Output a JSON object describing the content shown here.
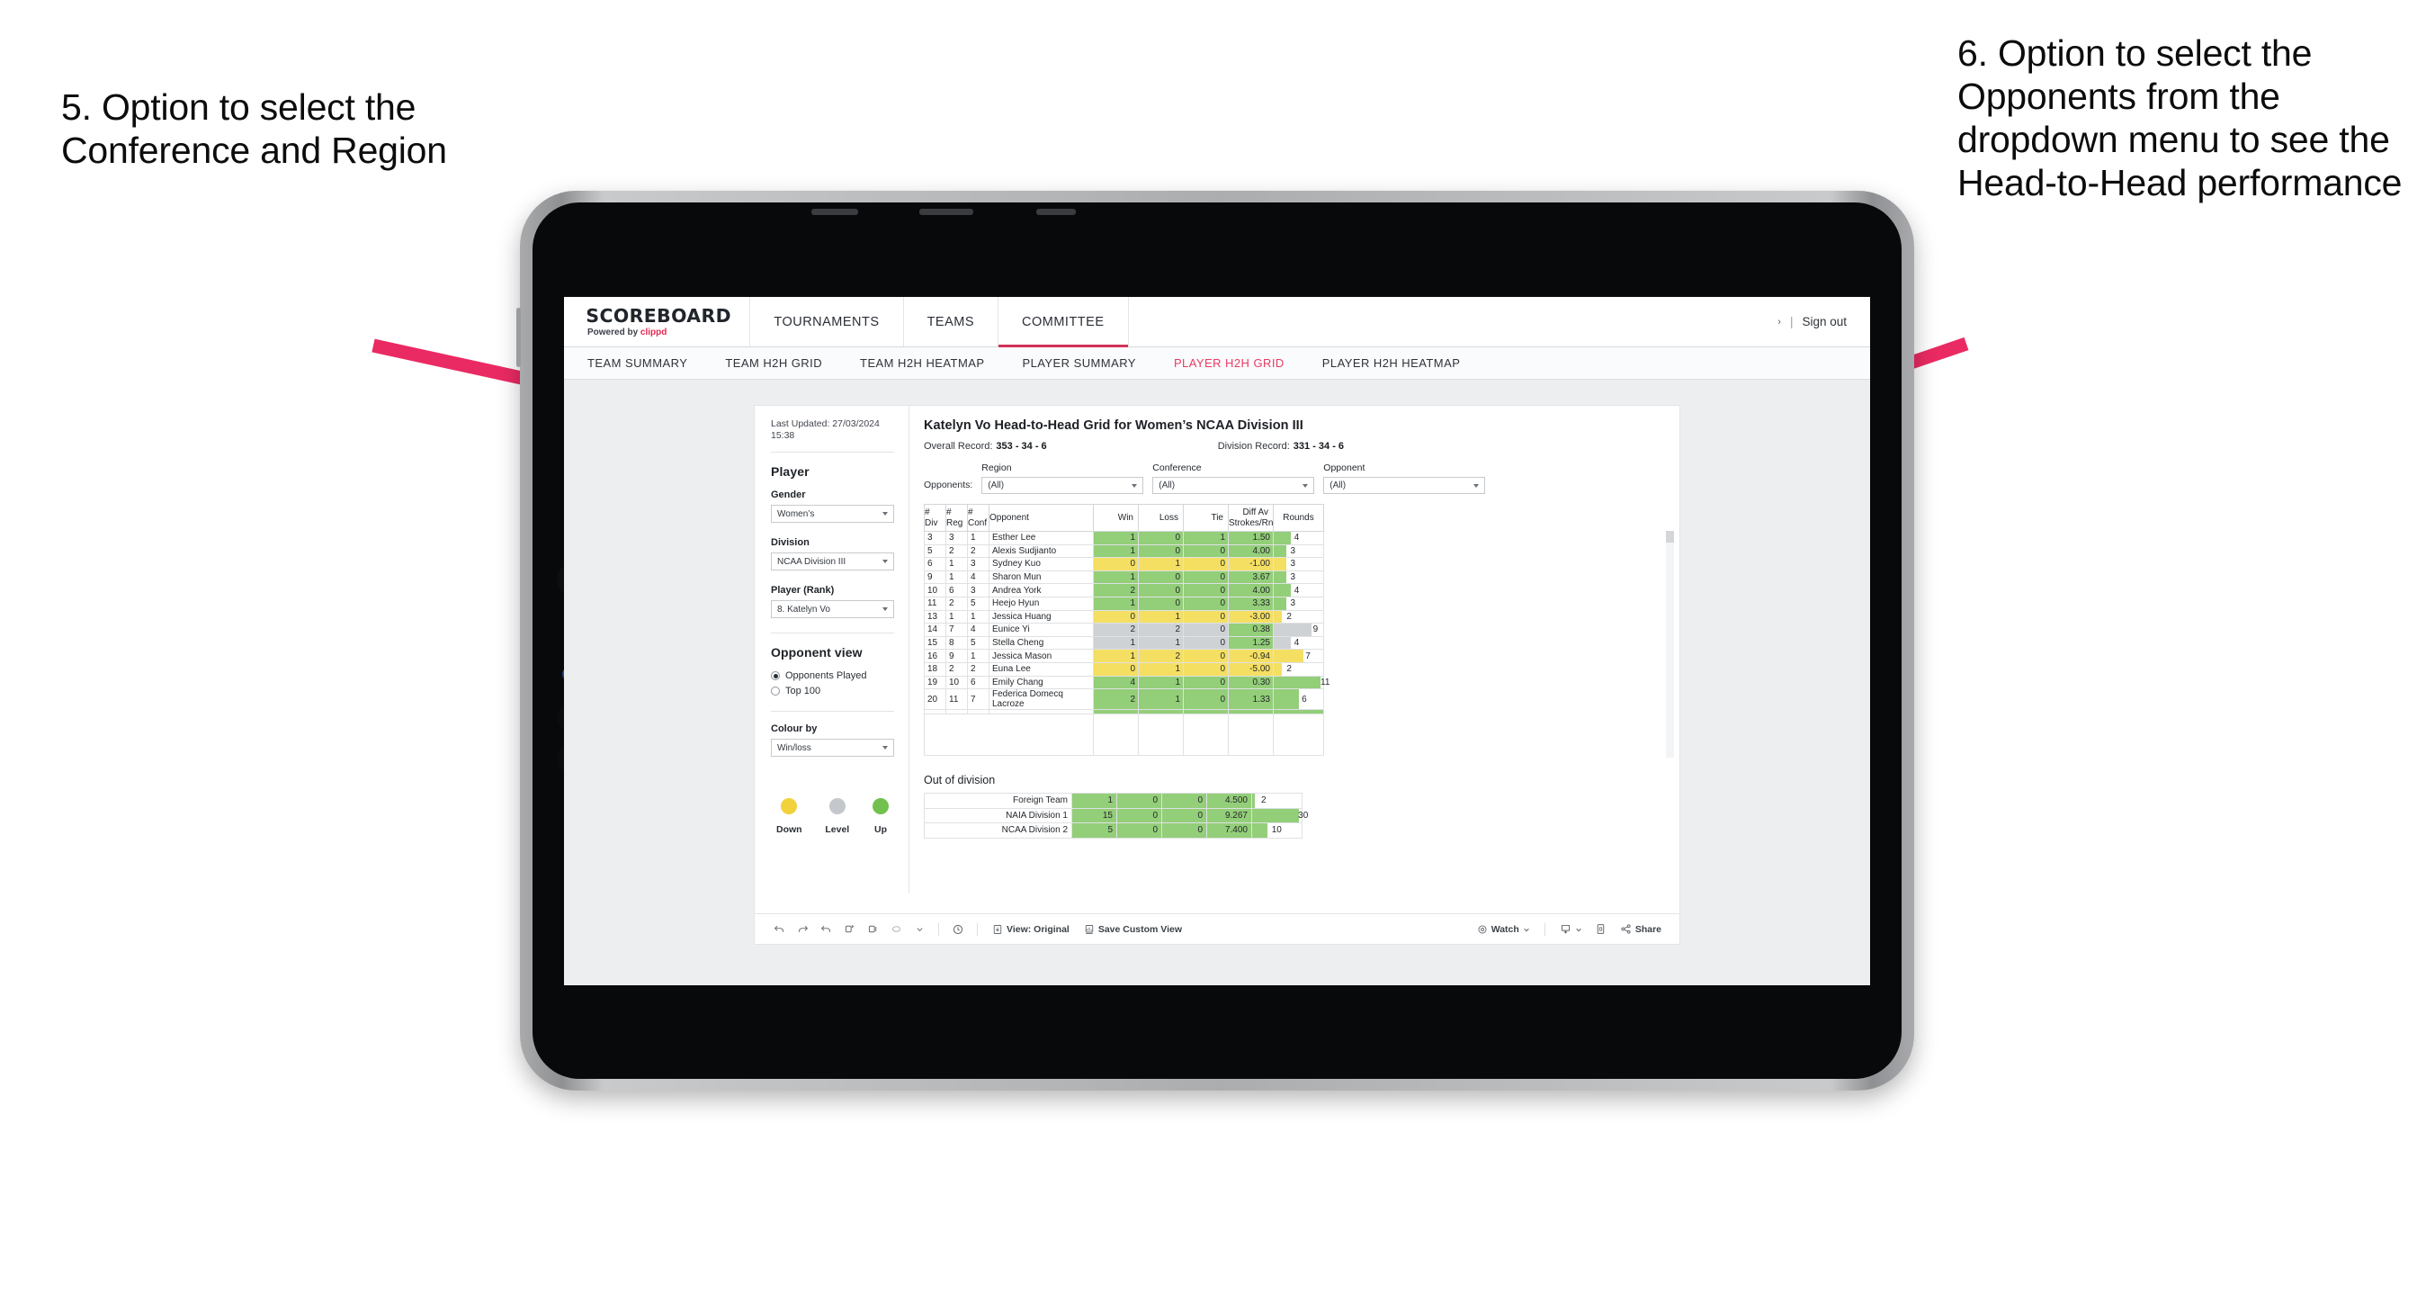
{
  "annotations": {
    "left": "5. Option to select the Conference and Region",
    "right": "6. Option to select the Opponents from the dropdown menu to see the Head-to-Head performance",
    "arrow_color": "#ea2a63"
  },
  "appbar": {
    "logo": "SCOREBOARD",
    "logo_sub_prefix": "Powered by ",
    "logo_sub_brand": "clippd",
    "nav": [
      {
        "label": "TOURNAMENTS",
        "active": false
      },
      {
        "label": "TEAMS",
        "active": false
      },
      {
        "label": "COMMITTEE",
        "active": true
      }
    ],
    "user_caret": "›",
    "separator": "|",
    "sign_out": "Sign out"
  },
  "subnav": [
    {
      "label": "TEAM SUMMARY",
      "active": false
    },
    {
      "label": "TEAM H2H GRID",
      "active": false
    },
    {
      "label": "TEAM H2H HEATMAP",
      "active": false
    },
    {
      "label": "PLAYER SUMMARY",
      "active": false
    },
    {
      "label": "PLAYER H2H GRID",
      "active": true
    },
    {
      "label": "PLAYER H2H HEATMAP",
      "active": false
    }
  ],
  "sidebar": {
    "last_updated": "Last Updated: 27/03/2024 15:38",
    "player_heading": "Player",
    "fields": [
      {
        "label": "Gender",
        "value": "Women’s"
      },
      {
        "label": "Division",
        "value": "NCAA Division III"
      },
      {
        "label": "Player (Rank)",
        "value": "8. Katelyn Vo"
      }
    ],
    "opponent_view_heading": "Opponent view",
    "opponent_view_options": [
      {
        "label": "Opponents Played",
        "selected": true
      },
      {
        "label": "Top 100",
        "selected": false
      }
    ],
    "colour_by_label": "Colour by",
    "colour_by_value": "Win/loss",
    "legend": [
      {
        "label": "Down",
        "color": "#f2d13b"
      },
      {
        "label": "Level",
        "color": "#c4c8cc"
      },
      {
        "label": "Up",
        "color": "#72c14e"
      }
    ]
  },
  "main": {
    "title": "Katelyn Vo Head-to-Head Grid for Women’s NCAA Division III",
    "overall_record_label": "Overall Record:",
    "overall_record_value": "353 - 34 - 6",
    "division_record_label": "Division Record:",
    "division_record_value": "331 - 34 - 6",
    "opponents_label": "Opponents:",
    "filters": [
      {
        "label": "Region",
        "value": "(All)"
      },
      {
        "label": "Conference",
        "value": "(All)"
      },
      {
        "label": "Opponent",
        "value": "(All)"
      }
    ],
    "out_of_division_heading": "Out of division"
  },
  "chart_data": {
    "type": "table",
    "title": "Katelyn Vo Head-to-Head Grid for Women’s NCAA Division III",
    "colors": {
      "up": "#93ce78",
      "down": "#f5df62",
      "level": "#cfd2d5"
    },
    "columns": [
      "# Div",
      "# Reg",
      "# Conf",
      "Opponent",
      "Win",
      "Loss",
      "Tie",
      "Diff Av Strokes/Rnd",
      "Rounds"
    ],
    "headers": [
      {
        "l1": "#",
        "l2": "Div"
      },
      {
        "l1": "#",
        "l2": "Reg"
      },
      {
        "l1": "#",
        "l2": "Conf"
      },
      {
        "l1": "Opponent",
        "l2": ""
      },
      {
        "l1": "Win",
        "l2": ""
      },
      {
        "l1": "Loss",
        "l2": ""
      },
      {
        "l1": "Tie",
        "l2": ""
      },
      {
        "l1": "Diff Av",
        "l2": "Strokes/Rnd"
      },
      {
        "l1": "Rounds",
        "l2": ""
      }
    ],
    "rounds_max": 11,
    "rows": [
      {
        "div": "3",
        "reg": "3",
        "conf": "1",
        "opponent": "Esther Lee",
        "win": "1",
        "loss": "0",
        "tie": "1",
        "diff": "1.50",
        "rounds": "4",
        "state": "up"
      },
      {
        "div": "5",
        "reg": "2",
        "conf": "2",
        "opponent": "Alexis Sudjianto",
        "win": "1",
        "loss": "0",
        "tie": "0",
        "diff": "4.00",
        "rounds": "3",
        "state": "up"
      },
      {
        "div": "6",
        "reg": "1",
        "conf": "3",
        "opponent": "Sydney Kuo",
        "win": "0",
        "loss": "1",
        "tie": "0",
        "diff": "-1.00",
        "rounds": "3",
        "state": "down"
      },
      {
        "div": "9",
        "reg": "1",
        "conf": "4",
        "opponent": "Sharon Mun",
        "win": "1",
        "loss": "0",
        "tie": "0",
        "diff": "3.67",
        "rounds": "3",
        "state": "up"
      },
      {
        "div": "10",
        "reg": "6",
        "conf": "3",
        "opponent": "Andrea York",
        "win": "2",
        "loss": "0",
        "tie": "0",
        "diff": "4.00",
        "rounds": "4",
        "state": "up"
      },
      {
        "div": "11",
        "reg": "2",
        "conf": "5",
        "opponent": "Heejo Hyun",
        "win": "1",
        "loss": "0",
        "tie": "0",
        "diff": "3.33",
        "rounds": "3",
        "state": "up"
      },
      {
        "div": "13",
        "reg": "1",
        "conf": "1",
        "opponent": "Jessica Huang",
        "win": "0",
        "loss": "1",
        "tie": "0",
        "diff": "-3.00",
        "rounds": "2",
        "state": "down"
      },
      {
        "div": "14",
        "reg": "7",
        "conf": "4",
        "opponent": "Eunice Yi",
        "win": "2",
        "loss": "2",
        "tie": "0",
        "diff": "0.38",
        "rounds": "9",
        "state": "level",
        "diff_state": "up"
      },
      {
        "div": "15",
        "reg": "8",
        "conf": "5",
        "opponent": "Stella Cheng",
        "win": "1",
        "loss": "1",
        "tie": "0",
        "diff": "1.25",
        "rounds": "4",
        "state": "level",
        "diff_state": "up"
      },
      {
        "div": "16",
        "reg": "9",
        "conf": "1",
        "opponent": "Jessica Mason",
        "win": "1",
        "loss": "2",
        "tie": "0",
        "diff": "-0.94",
        "rounds": "7",
        "state": "down"
      },
      {
        "div": "18",
        "reg": "2",
        "conf": "2",
        "opponent": "Euna Lee",
        "win": "0",
        "loss": "1",
        "tie": "0",
        "diff": "-5.00",
        "rounds": "2",
        "state": "down"
      },
      {
        "div": "19",
        "reg": "10",
        "conf": "6",
        "opponent": "Emily Chang",
        "win": "4",
        "loss": "1",
        "tie": "0",
        "diff": "0.30",
        "rounds": "11",
        "state": "up"
      },
      {
        "div": "20",
        "reg": "11",
        "conf": "7",
        "opponent": "Federica Domecq Lacroze",
        "win": "2",
        "loss": "1",
        "tie": "0",
        "diff": "1.33",
        "rounds": "6",
        "state": "up"
      }
    ],
    "out_of_division": {
      "rounds_max": 30,
      "rows": [
        {
          "label": "Foreign Team",
          "win": "1",
          "loss": "0",
          "tie": "0",
          "diff": "4.500",
          "rounds": "2",
          "state": "up"
        },
        {
          "label": "NAIA Division 1",
          "win": "15",
          "loss": "0",
          "tie": "0",
          "diff": "9.267",
          "rounds": "30",
          "state": "up"
        },
        {
          "label": "NCAA Division 2",
          "win": "5",
          "loss": "0",
          "tie": "0",
          "diff": "7.400",
          "rounds": "10",
          "state": "up"
        }
      ]
    }
  },
  "toolbar": {
    "icons": [
      "undo-icon",
      "redo-icon",
      "revert-icon",
      "refresh-icon",
      "pause-icon",
      "shape-icon",
      "chevron-down-icon"
    ],
    "alerts_icon": "alerts-icon",
    "view_label": "View: Original",
    "save_custom_view_label": "Save Custom View",
    "watch_label": "Watch",
    "download_icon": "download-icon",
    "fullscreen_icon": "fullscreen-icon",
    "share_label": "Share"
  }
}
